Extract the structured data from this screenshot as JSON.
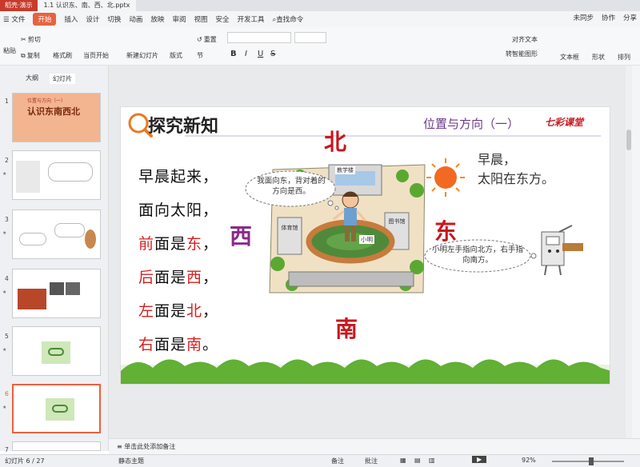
{
  "titlebar": {
    "app_tab": "稻壳·演示",
    "doc_tab": "1.1 认识东、南、西、北.pptx"
  },
  "menu": {
    "file": "文件",
    "items": [
      "开始",
      "插入",
      "设计",
      "切换",
      "动画",
      "放映",
      "审阅",
      "视图",
      "安全",
      "开发工具"
    ],
    "search": "查找命令",
    "right": [
      "未同步",
      "协作",
      "分享"
    ]
  },
  "ribbon": {
    "paste": "粘贴",
    "cut": "剪切",
    "copy": "复制",
    "format_painter": "格式刷",
    "from_current": "当页开始",
    "new_slide": "新建幻灯片",
    "layout": "版式",
    "section": "节",
    "reset": "重置",
    "align_text": "对齐文本",
    "smartart": "转智能图形",
    "textbox": "文本框",
    "shape": "形状",
    "arrange": "排列"
  },
  "leftpane": {
    "tabs": [
      "大纲",
      "幻灯片"
    ],
    "thumb_numbers": [
      "1",
      "2",
      "3",
      "4",
      "5",
      "6",
      "7"
    ],
    "thumb1_title": "认识东南西北",
    "thumb1_sub": "位置与方向（一）"
  },
  "slide": {
    "header": "探究新知",
    "subtitle": "位置与方向（一）",
    "brand": "七彩课堂",
    "poem": {
      "l1": "早晨起来，",
      "l2": "面向太阳，",
      "l3a": "前",
      "l3b": "面是",
      "l3c": "东",
      "l3d": "，",
      "l4a": "后",
      "l4b": "面是",
      "l4c": "西",
      "l4d": "，",
      "l5a": "左",
      "l5b": "面是",
      "l5c": "北",
      "l5d": "，",
      "l6a": "右",
      "l6b": "面是",
      "l6c": "南",
      "l6d": "。"
    },
    "north": "北",
    "south": "南",
    "east": "东",
    "west": "西",
    "morning_l1": "早晨，",
    "morning_l2": "太阳在东方。",
    "bubble_left": "我面向东，背对着的方向是西。",
    "bubble_right": "小明左手指向北方，右手指向南方。",
    "school_building": "教学楼",
    "gym": "体育馆",
    "library": "图书馆",
    "xiaoming": "小明"
  },
  "notes": {
    "placeholder": "单击此处添加备注"
  },
  "status": {
    "slide_info": "幻灯片 6 / 27",
    "theme": "静态主题",
    "notes_btn": "备注",
    "comment_btn": "批注",
    "zoom": "92%"
  },
  "colors": {
    "accent": "#e8623f",
    "slide_red": "#d42020",
    "compass_red": "#c8171e",
    "compass_purple": "#8a2a8a",
    "grass": "#5aa832"
  }
}
